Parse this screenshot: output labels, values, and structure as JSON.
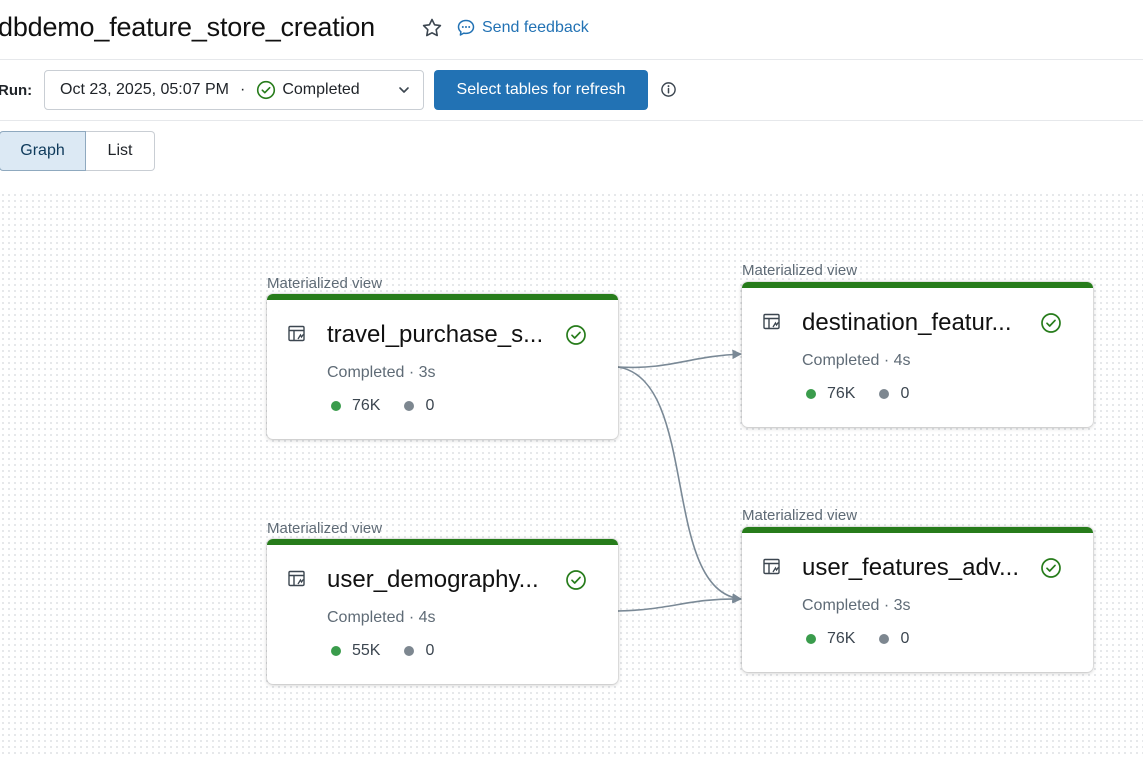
{
  "header": {
    "title": "dbdemo_feature_store_creation",
    "feedback_label": "Send feedback"
  },
  "run": {
    "label": "Run:",
    "date": "Oct 23, 2025, 05:07 PM",
    "separator": "·",
    "status": "Completed",
    "refresh_button": "Select tables for refresh"
  },
  "view_toggle": {
    "options": [
      "Graph",
      "List"
    ],
    "selected": "Graph"
  },
  "colors": {
    "accent": "#2272b4",
    "success": "#277c1b",
    "edge": "#7a8996"
  },
  "nodes": [
    {
      "type": "Materialized view",
      "name": "travel_purchase_s...",
      "status": "Completed · 3s",
      "rows": "76K",
      "dropped": "0"
    },
    {
      "type": "Materialized view",
      "name": "user_demography...",
      "status": "Completed · 4s",
      "rows": "55K",
      "dropped": "0"
    },
    {
      "type": "Materialized view",
      "name": "destination_featur...",
      "status": "Completed · 4s",
      "rows": "76K",
      "dropped": "0"
    },
    {
      "type": "Materialized view",
      "name": "user_features_adv...",
      "status": "Completed · 3s",
      "rows": "76K",
      "dropped": "0"
    }
  ],
  "edges": [
    {
      "from": "travel_purchase_s...",
      "to": "destination_featur..."
    },
    {
      "from": "travel_purchase_s...",
      "to": "user_features_adv..."
    },
    {
      "from": "user_demography...",
      "to": "user_features_adv..."
    }
  ]
}
